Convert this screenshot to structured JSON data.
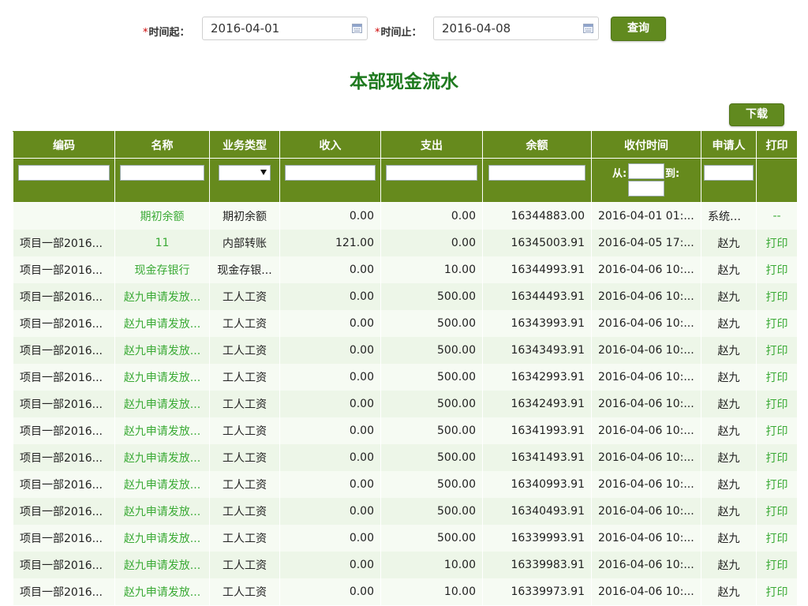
{
  "filter": {
    "required_mark": "*",
    "start_label": "时间起：",
    "start_value": "2016-04-01",
    "end_label": "时间止：",
    "end_value": "2016-04-08",
    "query_button": "查询"
  },
  "title": "本部现金流水",
  "download_button": "下载",
  "table": {
    "columns": [
      "编码",
      "名称",
      "业务类型",
      "收入",
      "支出",
      "余额",
      "收付时间",
      "申请人",
      "打印"
    ],
    "range_from": "从:",
    "range_to": "到:",
    "rows": [
      {
        "code": "",
        "name": "期初余额",
        "type": "期初余额",
        "income": "0.00",
        "expense": "0.00",
        "balance": "16344883.00",
        "time": "2016-04-01 01:...",
        "applicant": "系统自...",
        "print": "--"
      },
      {
        "code": "项目一部2016...",
        "name": "11",
        "type": "内部转账",
        "income": "121.00",
        "expense": "0.00",
        "balance": "16345003.91",
        "time": "2016-04-05 17:...",
        "applicant": "赵九",
        "print": "打印"
      },
      {
        "code": "项目一部2016...",
        "name": "现金存银行",
        "type": "现金存银...",
        "income": "0.00",
        "expense": "10.00",
        "balance": "16344993.91",
        "time": "2016-04-06 10:...",
        "applicant": "赵九",
        "print": "打印"
      },
      {
        "code": "项目一部2016...",
        "name": "赵九申请发放...",
        "type": "工人工资",
        "income": "0.00",
        "expense": "500.00",
        "balance": "16344493.91",
        "time": "2016-04-06 10:...",
        "applicant": "赵九",
        "print": "打印"
      },
      {
        "code": "项目一部2016...",
        "name": "赵九申请发放...",
        "type": "工人工资",
        "income": "0.00",
        "expense": "500.00",
        "balance": "16343993.91",
        "time": "2016-04-06 10:...",
        "applicant": "赵九",
        "print": "打印"
      },
      {
        "code": "项目一部2016...",
        "name": "赵九申请发放...",
        "type": "工人工资",
        "income": "0.00",
        "expense": "500.00",
        "balance": "16343493.91",
        "time": "2016-04-06 10:...",
        "applicant": "赵九",
        "print": "打印"
      },
      {
        "code": "项目一部2016...",
        "name": "赵九申请发放...",
        "type": "工人工资",
        "income": "0.00",
        "expense": "500.00",
        "balance": "16342993.91",
        "time": "2016-04-06 10:...",
        "applicant": "赵九",
        "print": "打印"
      },
      {
        "code": "项目一部2016...",
        "name": "赵九申请发放...",
        "type": "工人工资",
        "income": "0.00",
        "expense": "500.00",
        "balance": "16342493.91",
        "time": "2016-04-06 10:...",
        "applicant": "赵九",
        "print": "打印"
      },
      {
        "code": "项目一部2016...",
        "name": "赵九申请发放...",
        "type": "工人工资",
        "income": "0.00",
        "expense": "500.00",
        "balance": "16341993.91",
        "time": "2016-04-06 10:...",
        "applicant": "赵九",
        "print": "打印"
      },
      {
        "code": "项目一部2016...",
        "name": "赵九申请发放...",
        "type": "工人工资",
        "income": "0.00",
        "expense": "500.00",
        "balance": "16341493.91",
        "time": "2016-04-06 10:...",
        "applicant": "赵九",
        "print": "打印"
      },
      {
        "code": "项目一部2016...",
        "name": "赵九申请发放...",
        "type": "工人工资",
        "income": "0.00",
        "expense": "500.00",
        "balance": "16340993.91",
        "time": "2016-04-06 10:...",
        "applicant": "赵九",
        "print": "打印"
      },
      {
        "code": "项目一部2016...",
        "name": "赵九申请发放...",
        "type": "工人工资",
        "income": "0.00",
        "expense": "500.00",
        "balance": "16340493.91",
        "time": "2016-04-06 10:...",
        "applicant": "赵九",
        "print": "打印"
      },
      {
        "code": "项目一部2016...",
        "name": "赵九申请发放...",
        "type": "工人工资",
        "income": "0.00",
        "expense": "500.00",
        "balance": "16339993.91",
        "time": "2016-04-06 10:...",
        "applicant": "赵九",
        "print": "打印"
      },
      {
        "code": "项目一部2016...",
        "name": "赵九申请发放...",
        "type": "工人工资",
        "income": "0.00",
        "expense": "10.00",
        "balance": "16339983.91",
        "time": "2016-04-06 10:...",
        "applicant": "赵九",
        "print": "打印"
      },
      {
        "code": "项目一部2016...",
        "name": "赵九申请发放...",
        "type": "工人工资",
        "income": "0.00",
        "expense": "10.00",
        "balance": "16339973.91",
        "time": "2016-04-06 10:...",
        "applicant": "赵九",
        "print": "打印"
      }
    ]
  },
  "colors": {
    "header_green": "#668a1d",
    "button_green": "#618a1f",
    "title_green": "#1f7a1f",
    "link_green": "#3aaa35",
    "required_red": "#cc0000"
  }
}
